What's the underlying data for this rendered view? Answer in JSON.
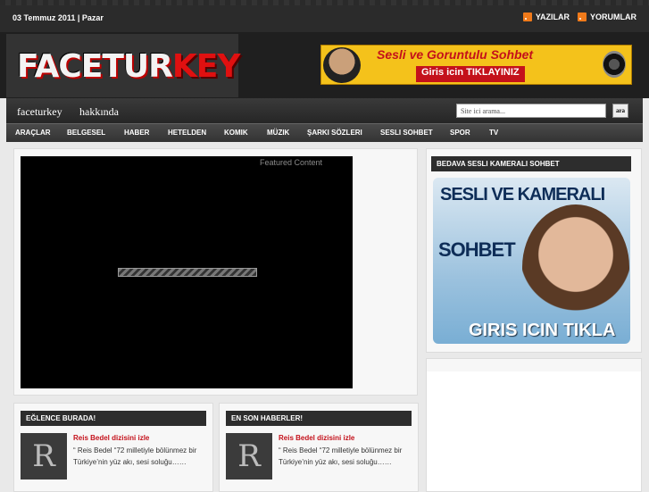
{
  "topbar": {
    "date": "03 Temmuz 2011 | Pazar",
    "feeds": [
      {
        "icon": "rss-icon",
        "label": "YAZILAR"
      },
      {
        "icon": "rss-icon",
        "label": "YORUMLAR"
      }
    ]
  },
  "header": {
    "logo_part1": "FACETUR",
    "logo_part2": "KEY",
    "banner": {
      "title": "Sesli ve Goruntulu Sohbet",
      "sub": "Giris icin TIKLAYINIZ"
    }
  },
  "nav": {
    "pages": [
      "faceturkey",
      "hakkında"
    ],
    "search_placeholder": "Site ici arama...",
    "search_button": "ara",
    "categories": [
      "ARAÇLAR",
      "BELGESEL",
      "HABER",
      "HETELDEN",
      "KOMIK",
      "MÜZIK",
      "ŞARKI SÖZLERI",
      "SESLI SOHBET",
      "SPOR",
      "TV"
    ]
  },
  "featured": {
    "label": "Featured Content"
  },
  "sidebar": {
    "heading": "BEDAVA SESLI KAMERALI SOHBET",
    "ad": {
      "line1": "SESLI VE KAMERALI",
      "line2": "SOHBET",
      "line3": "GIRIS ICIN TIKLA"
    }
  },
  "columns": [
    {
      "heading": "EĞLENCE BURADA!",
      "thumb_letter": "R",
      "title": "Reis Bedel dizisini izle",
      "excerpt": "“ Reis Bedel “72 milletiyle bölünmez bir Türkiye’nin yüz akı, sesi soluğu……"
    },
    {
      "heading": "EN SON HABERLER!",
      "thumb_letter": "R",
      "title": "Reis Bedel dizisini izle",
      "excerpt": "“ Reis Bedel “72 milletiyle bölünmez bir Türkiye’nin yüz akı, sesi soluğu……"
    }
  ]
}
